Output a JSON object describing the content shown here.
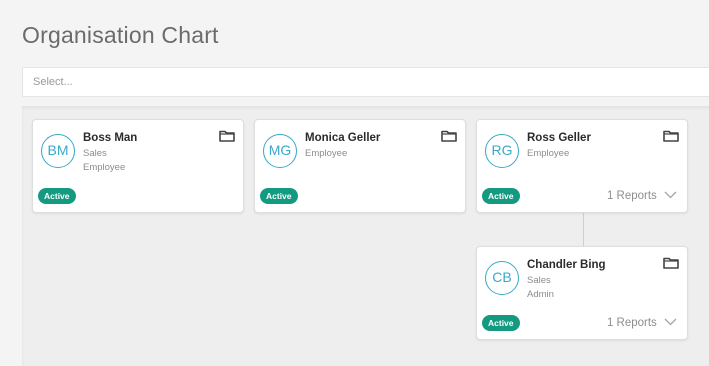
{
  "page": {
    "title": "Organisation Chart"
  },
  "select": {
    "placeholder": "Select..."
  },
  "cards": [
    {
      "initials": "BM",
      "name": "Boss Man",
      "line1": "Sales",
      "line2": "Employee",
      "status": "Active",
      "reports": ""
    },
    {
      "initials": "MG",
      "name": "Monica Geller",
      "line1": "Employee",
      "line2": "",
      "status": "Active",
      "reports": ""
    },
    {
      "initials": "RG",
      "name": "Ross Geller",
      "line1": "Employee",
      "line2": "",
      "status": "Active",
      "reports": "1 Reports"
    },
    {
      "initials": "CB",
      "name": "Chandler Bing",
      "line1": "Sales",
      "line2": "Admin",
      "status": "Active",
      "reports": "1 Reports"
    }
  ],
  "colors": {
    "avatar_accent": "#3aa8c8",
    "active_badge": "#159a82"
  },
  "icons": {
    "folder": "folder-icon",
    "expand": "chevron-down-icon"
  }
}
